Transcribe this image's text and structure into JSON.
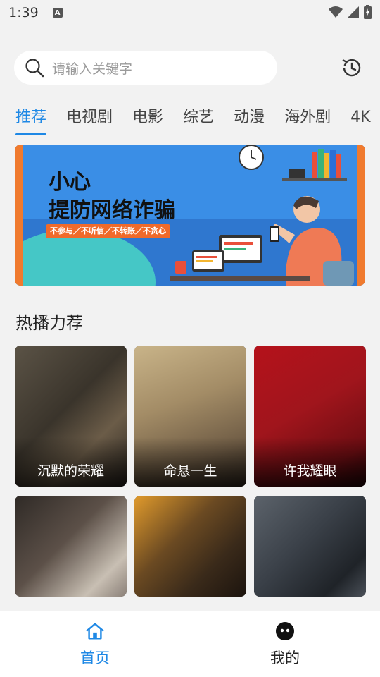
{
  "status_bar": {
    "time": "1:39",
    "notification_badge": "A"
  },
  "search": {
    "placeholder": "请输入关键字",
    "history_icon": "history-icon"
  },
  "tabs": [
    {
      "label": "推荐",
      "active": true
    },
    {
      "label": "电视剧",
      "active": false
    },
    {
      "label": "电影",
      "active": false
    },
    {
      "label": "综艺",
      "active": false
    },
    {
      "label": "动漫",
      "active": false
    },
    {
      "label": "海外剧",
      "active": false
    },
    {
      "label": "4K",
      "active": false
    }
  ],
  "banner": {
    "title_line1": "小心",
    "title_line2": "提防网络诈骗",
    "tagline": "不参与／不听信／不转账／不贪心"
  },
  "section": {
    "title": "热播力荐"
  },
  "cards": [
    {
      "title": "沉默的荣耀"
    },
    {
      "title": "命悬一生"
    },
    {
      "title": "许我耀眼"
    },
    {
      "title": ""
    },
    {
      "title": ""
    },
    {
      "title": ""
    }
  ],
  "bottom_nav": [
    {
      "label": "首页",
      "icon": "home-icon",
      "active": true
    },
    {
      "label": "我的",
      "icon": "profile-icon",
      "active": false
    }
  ],
  "colors": {
    "accent": "#1e88e5",
    "background": "#f2f2f2"
  }
}
